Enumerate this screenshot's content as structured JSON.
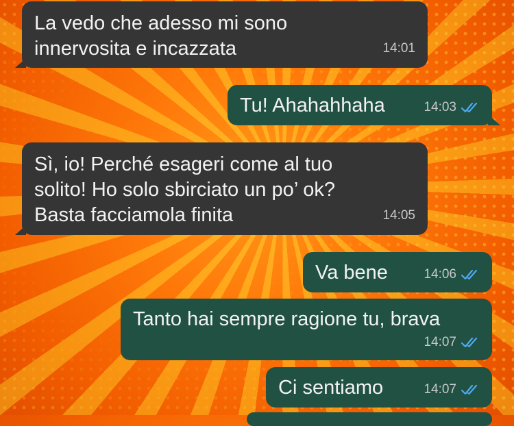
{
  "messages": [
    {
      "from": "in",
      "lines": [
        "La vedo che adesso mi sono",
        "innervosita e incazzata"
      ],
      "time": "14:01"
    },
    {
      "from": "out",
      "lines": [
        "Tu! Ahahahhaha"
      ],
      "time": "14:03",
      "status": "read"
    },
    {
      "from": "in",
      "lines": [
        "Sì, io! Perché esageri come al tuo",
        "solito! Ho solo sbirciato un po’ ok?",
        "Basta facciamola finita"
      ],
      "time": "14:05"
    },
    {
      "from": "out",
      "lines": [
        "Va bene"
      ],
      "time": "14:06",
      "status": "read"
    },
    {
      "from": "out",
      "lines": [
        "Tanto hai sempre ragione tu, brava"
      ],
      "time": "14:07",
      "status": "read"
    },
    {
      "from": "out",
      "lines": [
        "Ci sentiamo"
      ],
      "time": "14:07",
      "status": "read"
    }
  ],
  "colors": {
    "incoming_bubble": "#353535",
    "outgoing_bubble": "#205143",
    "read_ticks": "#4fa9f2",
    "background": "#ff7a0a"
  },
  "icons": {
    "read_receipt": "double-check-icon"
  }
}
